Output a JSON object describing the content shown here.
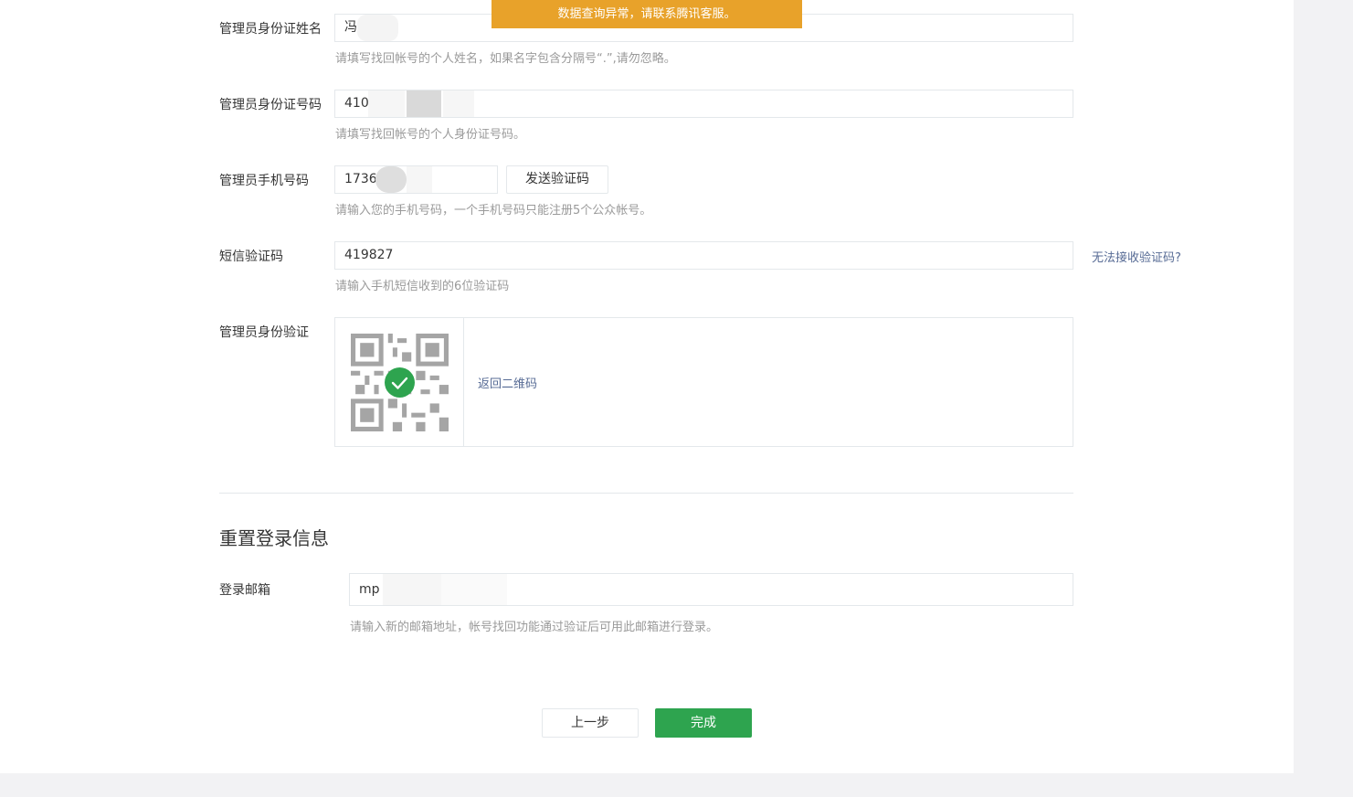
{
  "toast": {
    "text": "数据查询异常，请联系腾讯客服。"
  },
  "form": {
    "admin_name": {
      "label": "管理员身份证姓名",
      "value": "冯",
      "hint": "请填写找回帐号的个人姓名，如果名字包含分隔号“.”,请勿忽略。"
    },
    "admin_id": {
      "label": "管理员身份证号码",
      "value": "410",
      "hint": "请填写找回帐号的个人身份证号码。"
    },
    "admin_phone": {
      "label": "管理员手机号码",
      "value": "1736",
      "send_button": "发送验证码",
      "hint": "请输入您的手机号码，一个手机号码只能注册5个公众帐号。"
    },
    "sms_code": {
      "label": "短信验证码",
      "value": "419827",
      "help_link": "无法接收验证码?",
      "hint": "请输入手机短信收到的6位验证码"
    },
    "admin_verify": {
      "label": "管理员身份验证",
      "back_link": "返回二维码",
      "status": "verified"
    }
  },
  "reset_section": {
    "title": "重置登录信息",
    "email": {
      "label": "登录邮箱",
      "value": "mp",
      "hint": "请输入新的邮箱地址，帐号找回功能通过验证后可用此邮箱进行登录。"
    }
  },
  "buttons": {
    "prev": "上一步",
    "done": "完成"
  },
  "colors": {
    "toast_bg": "#e8a22a",
    "primary": "#2ea44f",
    "link": "#576b95",
    "hint": "#9a9a9a"
  }
}
